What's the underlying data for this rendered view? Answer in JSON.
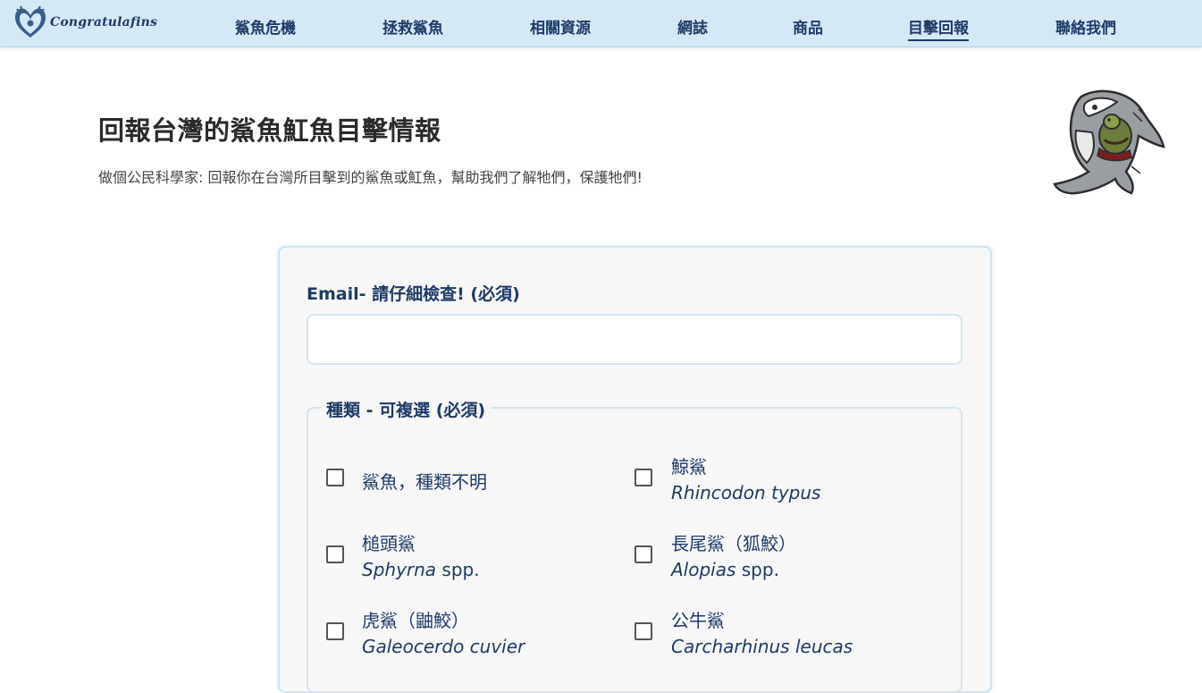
{
  "brand": {
    "name": "Congratulafins"
  },
  "nav": {
    "items": [
      {
        "label": "鯊魚危機"
      },
      {
        "label": "拯救鯊魚"
      },
      {
        "label": "相關資源"
      },
      {
        "label": "網誌"
      },
      {
        "label": "商品"
      },
      {
        "label": "目擊回報",
        "active": true
      },
      {
        "label": "聯絡我們"
      }
    ]
  },
  "page": {
    "title": "回報台灣的鯊魚魟魚目擊情報",
    "subtitle": "做個公民科學家: 回報你在台灣所目擊到的鯊魚或魟魚，幫助我們了解牠們，保護牠們!"
  },
  "form": {
    "email_label": "Email- 請仔細檢查! (必須)",
    "email_value": "",
    "species_legend": "種類 - 可複選 (必須)",
    "species": [
      {
        "name": "鯊魚，種類不明",
        "sci": "",
        "sci_suffix": "",
        "checked": false
      },
      {
        "name": "鯨鯊",
        "sci": "Rhincodon typus",
        "sci_suffix": "",
        "checked": false
      },
      {
        "name": "槌頭鯊",
        "sci": "Sphyrna",
        "sci_suffix": " spp.",
        "checked": false
      },
      {
        "name": "長尾鯊（狐鮫）",
        "sci": "Alopias",
        "sci_suffix": " spp.",
        "checked": false
      },
      {
        "name": "虎鯊（鼬鮫）",
        "sci": "Galeocerdo cuvier",
        "sci_suffix": "",
        "checked": false
      },
      {
        "name": "公牛鯊",
        "sci": "Carcharhinus leucas",
        "sci_suffix": "",
        "checked": false
      }
    ]
  },
  "colors": {
    "nav_bg": "#d4e8f6",
    "accent_text": "#1f3b66",
    "card_bg": "#f7f7f7",
    "border": "#d3e5f1"
  },
  "icons": {
    "logo": "winged-heart-logo-icon",
    "mascot": "shark-holding-turtle-illustration"
  }
}
